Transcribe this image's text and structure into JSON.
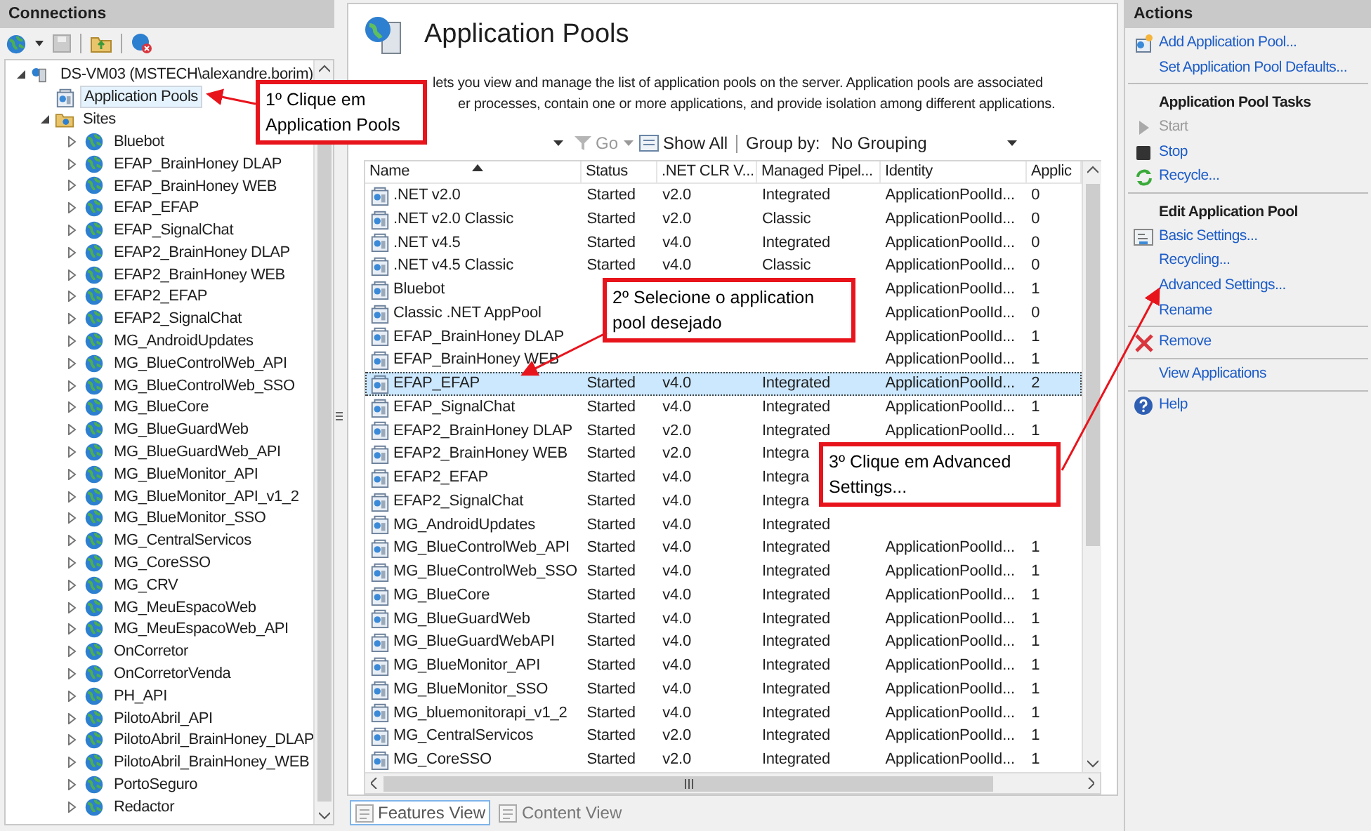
{
  "connections": {
    "title": "Connections",
    "server": {
      "label": "DS-VM03 (MSTECH\\alexandre.borim)",
      "expanded": true,
      "children": [
        {
          "label": "Application Pools",
          "selected": true,
          "kind": "pools"
        },
        {
          "label": "Sites",
          "selected": false,
          "kind": "sites",
          "expanded": true,
          "children": [
            {
              "label": "Bluebot",
              "expanded": false
            },
            {
              "label": "EFAP_BrainHoney DLAP",
              "expanded": false
            },
            {
              "label": "EFAP_BrainHoney WEB",
              "expanded": false
            },
            {
              "label": "EFAP_EFAP",
              "expanded": false
            },
            {
              "label": "EFAP_SignalChat",
              "expanded": false
            },
            {
              "label": "EFAP2_BrainHoney DLAP",
              "expanded": false
            },
            {
              "label": "EFAP2_BrainHoney WEB",
              "expanded": false
            },
            {
              "label": "EFAP2_EFAP",
              "expanded": false
            },
            {
              "label": "EFAP2_SignalChat",
              "expanded": false
            },
            {
              "label": "MG_AndroidUpdates",
              "expanded": false
            },
            {
              "label": "MG_BlueControlWeb_API",
              "expanded": false
            },
            {
              "label": "MG_BlueControlWeb_SSO",
              "expanded": false
            },
            {
              "label": "MG_BlueCore",
              "expanded": false
            },
            {
              "label": "MG_BlueGuardWeb",
              "expanded": false
            },
            {
              "label": "MG_BlueGuardWeb_API",
              "expanded": false
            },
            {
              "label": "MG_BlueMonitor_API",
              "expanded": false
            },
            {
              "label": "MG_BlueMonitor_API_v1_2",
              "expanded": false
            },
            {
              "label": "MG_BlueMonitor_SSO",
              "expanded": false
            },
            {
              "label": "MG_CentralServicos",
              "expanded": false
            },
            {
              "label": "MG_CoreSSO",
              "expanded": false
            },
            {
              "label": "MG_CRV",
              "expanded": false
            },
            {
              "label": "MG_MeuEspacoWeb",
              "expanded": false
            },
            {
              "label": "MG_MeuEspacoWeb_API",
              "expanded": false
            },
            {
              "label": "OnCorretor",
              "expanded": false
            },
            {
              "label": "OnCorretorVenda",
              "expanded": false
            },
            {
              "label": "PH_API",
              "expanded": false
            },
            {
              "label": "PilotoAbril_API",
              "expanded": false
            },
            {
              "label": "PilotoAbril_BrainHoney_DLAP",
              "expanded": false
            },
            {
              "label": "PilotoAbril_BrainHoney_WEB",
              "expanded": false
            },
            {
              "label": "PortoSeguro",
              "expanded": false
            },
            {
              "label": "Redactor",
              "expanded": false
            }
          ]
        }
      ]
    }
  },
  "main": {
    "title": "Application Pools",
    "description": [
      "lets you view and manage the list of application pools on the server. Application pools are associated",
      "er processes, contain one or more applications, and provide isolation among different applications."
    ],
    "filter": {
      "go": "Go",
      "show_all": "Show All",
      "group_by_label": "Group by:",
      "group_by_value": "No Grouping"
    },
    "columns": [
      "Name",
      "Status",
      ".NET CLR V...",
      "Managed Pipel...",
      "Identity",
      "Applic"
    ],
    "rows": [
      {
        "cells": [
          ".NET v2.0",
          "Started",
          "v2.0",
          "Integrated",
          "ApplicationPoolId...",
          "0"
        ],
        "selected": false
      },
      {
        "cells": [
          ".NET v2.0 Classic",
          "Started",
          "v2.0",
          "Classic",
          "ApplicationPoolId...",
          "0"
        ],
        "selected": false
      },
      {
        "cells": [
          ".NET v4.5",
          "Started",
          "v4.0",
          "Integrated",
          "ApplicationPoolId...",
          "0"
        ],
        "selected": false
      },
      {
        "cells": [
          ".NET v4.5 Classic",
          "Started",
          "v4.0",
          "Classic",
          "ApplicationPoolId...",
          "0"
        ],
        "selected": false
      },
      {
        "cells": [
          "Bluebot",
          null,
          null,
          null,
          "ApplicationPoolId...",
          "1"
        ],
        "selected": false
      },
      {
        "cells": [
          "Classic .NET AppPool",
          null,
          null,
          null,
          "ApplicationPoolId...",
          "0"
        ],
        "selected": false
      },
      {
        "cells": [
          "EFAP_BrainHoney DLAP",
          null,
          null,
          null,
          "ApplicationPoolId...",
          "1"
        ],
        "selected": false
      },
      {
        "cells": [
          "EFAP_BrainHoney WEB",
          null,
          null,
          null,
          "ApplicationPoolId...",
          "1"
        ],
        "selected": false
      },
      {
        "cells": [
          "EFAP_EFAP",
          "Started",
          "v4.0",
          "Integrated",
          "ApplicationPoolId...",
          "2"
        ],
        "selected": true
      },
      {
        "cells": [
          "EFAP_SignalChat",
          "Started",
          "v4.0",
          "Integrated",
          "ApplicationPoolId...",
          "1"
        ],
        "selected": false
      },
      {
        "cells": [
          "EFAP2_BrainHoney DLAP",
          "Started",
          "v2.0",
          "Integrated",
          "ApplicationPoolId...",
          "1"
        ],
        "selected": false
      },
      {
        "cells": [
          "EFAP2_BrainHoney WEB",
          "Started",
          "v2.0",
          "Integra",
          null,
          null
        ],
        "selected": false
      },
      {
        "cells": [
          "EFAP2_EFAP",
          "Started",
          "v4.0",
          "Integra",
          null,
          null
        ],
        "selected": false
      },
      {
        "cells": [
          "EFAP2_SignalChat",
          "Started",
          "v4.0",
          "Integra",
          null,
          null
        ],
        "selected": false
      },
      {
        "cells": [
          "MG_AndroidUpdates",
          "Started",
          "v4.0",
          "Integrated",
          null,
          null
        ],
        "selected": false
      },
      {
        "cells": [
          "MG_BlueControlWeb_API",
          "Started",
          "v4.0",
          "Integrated",
          "ApplicationPoolId...",
          "1"
        ],
        "selected": false
      },
      {
        "cells": [
          "MG_BlueControlWeb_SSO",
          "Started",
          "v4.0",
          "Integrated",
          "ApplicationPoolId...",
          "1"
        ],
        "selected": false
      },
      {
        "cells": [
          "MG_BlueCore",
          "Started",
          "v4.0",
          "Integrated",
          "ApplicationPoolId...",
          "1"
        ],
        "selected": false
      },
      {
        "cells": [
          "MG_BlueGuardWeb",
          "Started",
          "v4.0",
          "Integrated",
          "ApplicationPoolId...",
          "1"
        ],
        "selected": false
      },
      {
        "cells": [
          "MG_BlueGuardWebAPI",
          "Started",
          "v4.0",
          "Integrated",
          "ApplicationPoolId...",
          "1"
        ],
        "selected": false
      },
      {
        "cells": [
          "MG_BlueMonitor_API",
          "Started",
          "v4.0",
          "Integrated",
          "ApplicationPoolId...",
          "1"
        ],
        "selected": false
      },
      {
        "cells": [
          "MG_BlueMonitor_SSO",
          "Started",
          "v4.0",
          "Integrated",
          "ApplicationPoolId...",
          "1"
        ],
        "selected": false
      },
      {
        "cells": [
          "MG_bluemonitorapi_v1_2",
          "Started",
          "v4.0",
          "Integrated",
          "ApplicationPoolId...",
          "1"
        ],
        "selected": false
      },
      {
        "cells": [
          "MG_CentralServicos",
          "Started",
          "v2.0",
          "Integrated",
          "ApplicationPoolId...",
          "1"
        ],
        "selected": false
      },
      {
        "cells": [
          "MG_CoreSSO",
          "Started",
          "v2.0",
          "Integrated",
          "ApplicationPoolId...",
          "1"
        ],
        "selected": false
      }
    ],
    "views": [
      {
        "label": "Features View",
        "selected": true
      },
      {
        "label": "Content View",
        "selected": false
      }
    ]
  },
  "actions": {
    "title": "Actions",
    "groups": [
      [
        {
          "kind": "link",
          "label": "Add Application Pool...",
          "disabled": false
        },
        {
          "kind": "link",
          "label": "Set Application Pool Defaults...",
          "disabled": false
        }
      ],
      [
        {
          "kind": "heading",
          "label": "Application Pool Tasks"
        },
        {
          "kind": "link",
          "label": "Start",
          "disabled": true
        },
        {
          "kind": "link",
          "label": "Stop",
          "disabled": false
        },
        {
          "kind": "link",
          "label": "Recycle...",
          "disabled": false
        }
      ],
      [
        {
          "kind": "heading",
          "label": "Edit Application Pool"
        },
        {
          "kind": "link",
          "label": "Basic Settings...",
          "disabled": false
        },
        {
          "kind": "link",
          "label": "Recycling...",
          "disabled": false
        },
        {
          "kind": "link",
          "label": "Advanced Settings...",
          "disabled": false
        },
        {
          "kind": "link",
          "label": "Rename",
          "disabled": false
        }
      ],
      [
        {
          "kind": "link",
          "label": "Remove",
          "disabled": false
        }
      ],
      [
        {
          "kind": "link",
          "label": "View Applications",
          "disabled": false
        }
      ],
      [
        {
          "kind": "link",
          "label": "Help",
          "disabled": false
        }
      ]
    ]
  },
  "annotations": [
    {
      "text": "1º Clique em Application Pools"
    },
    {
      "text": "2º Selecione o application pool desejado"
    },
    {
      "text": "3º Clique em Advanced Settings..."
    }
  ]
}
